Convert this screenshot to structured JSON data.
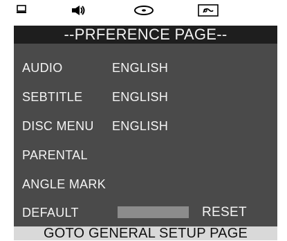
{
  "icons": [
    {
      "name": "monitor-icon"
    },
    {
      "name": "speaker-icon"
    },
    {
      "name": "disc-icon"
    },
    {
      "name": "preference-icon"
    }
  ],
  "page_title": "--PRFERENCE PAGE--",
  "menu": [
    {
      "label": "AUDIO",
      "value": "ENGLISH"
    },
    {
      "label": "SEBTITLE",
      "value": "ENGLISH"
    },
    {
      "label": "DISC MENU",
      "value": "ENGLISH"
    },
    {
      "label": "PARENTAL",
      "value": ""
    },
    {
      "label": "ANGLE MARK",
      "value": ""
    },
    {
      "label": "DEFAULT",
      "value": "RESET"
    }
  ],
  "footer_text": "GOTO GENERAL SETUP PAGE",
  "colors": {
    "title_bg": "#1e1e1e",
    "panel_bg": "#4a4a4a",
    "highlight_bar": "#8c8c8c",
    "footer_bg": "#d9d9d9"
  }
}
